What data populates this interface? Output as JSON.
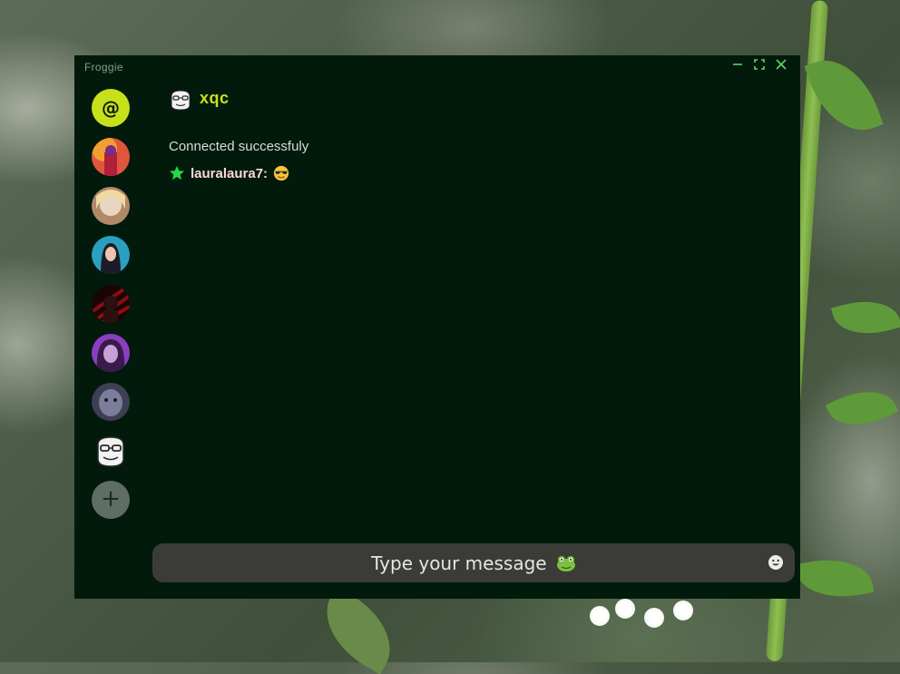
{
  "window": {
    "title": "Froggie",
    "controls": {
      "minimize_icon": "minimize-icon",
      "maximize_icon": "maximize-icon",
      "close_icon": "close-icon"
    }
  },
  "sidebar": {
    "mention_symbol": "@",
    "avatars": [
      {
        "name": "channel-avatar-1",
        "colors": [
          "#e0563c",
          "#7a2a8a"
        ]
      },
      {
        "name": "channel-avatar-2",
        "colors": [
          "#e8d6c2",
          "#b08a68"
        ]
      },
      {
        "name": "channel-avatar-3",
        "colors": [
          "#2a9fbf",
          "#1c1c28"
        ]
      },
      {
        "name": "channel-avatar-4",
        "colors": [
          "#8a0e12",
          "#1a0505"
        ]
      },
      {
        "name": "channel-avatar-5",
        "colors": [
          "#8a3ec0",
          "#c8a0d8"
        ]
      },
      {
        "name": "channel-avatar-6",
        "colors": [
          "#7c7d9a",
          "#3e3f52"
        ]
      },
      {
        "name": "channel-avatar-xqc",
        "colors": [
          "#f2f2f2",
          "#2a2a2a"
        ]
      }
    ],
    "add_symbol": "+"
  },
  "channel": {
    "name": "xqc",
    "icon": "gorilla-icon"
  },
  "messages": {
    "system": "Connected successfuly",
    "chat": [
      {
        "badge_icon": "star-badge-icon",
        "user": "lauralaura7:",
        "emote": "sunglasses-emoji-icon"
      }
    ]
  },
  "input": {
    "placeholder": "Type your message",
    "frog_icon": "frog-icon",
    "emoji_button_icon": "smiley-icon"
  },
  "colors": {
    "window_bg": "#011a0c",
    "accent": "#c6e01b",
    "username": "#ffd6dc",
    "input_bg": "#3b3c38",
    "window_controls": "#5fd36b"
  }
}
